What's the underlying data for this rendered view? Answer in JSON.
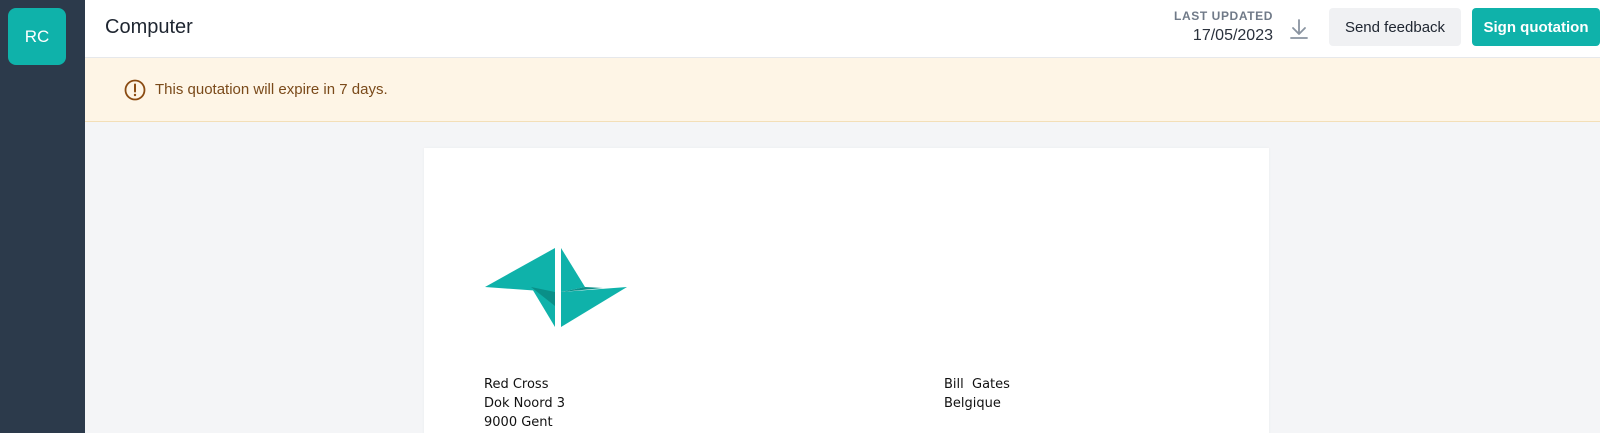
{
  "sidebar": {
    "avatar_initials": "RC"
  },
  "header": {
    "title": "Computer",
    "last_updated_label": "LAST UPDATED",
    "last_updated_date": "17/05/2023",
    "download_icon": "download-icon",
    "feedback_label": "Send feedback",
    "sign_label": "Sign quotation"
  },
  "banner": {
    "icon": "alert-circle-icon",
    "message": "This quotation will expire in 7 days."
  },
  "document": {
    "sender": {
      "line1": "Red Cross",
      "line2": "Dok Noord 3",
      "line3": "9000 Gent"
    },
    "recipient": {
      "line1": "Bill  Gates",
      "line2": "Belgique"
    }
  },
  "colors": {
    "accent": "#0fb2aa",
    "sidebar": "#2c3a4b",
    "banner_bg": "#fef5e6",
    "banner_text": "#7a4a1a"
  }
}
